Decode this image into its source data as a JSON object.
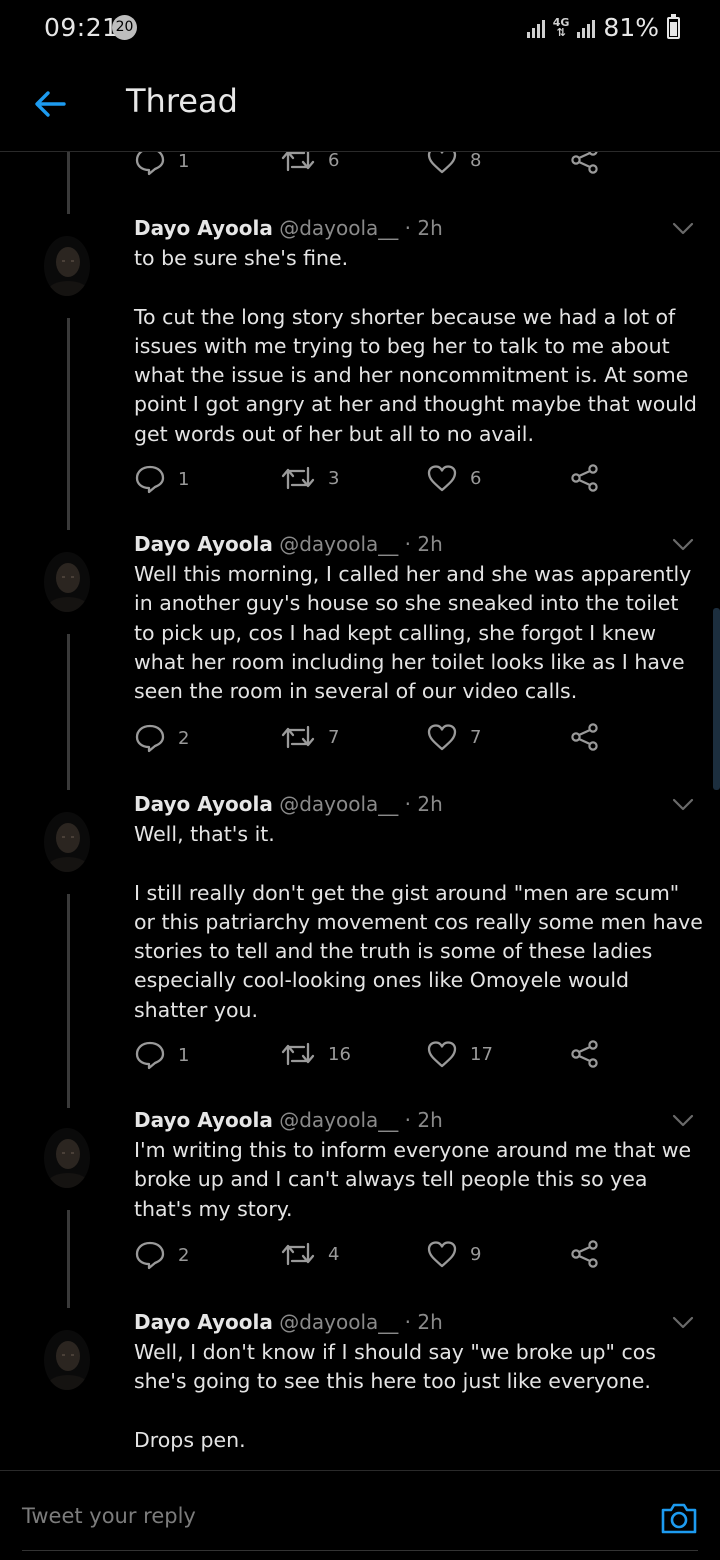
{
  "status_bar": {
    "time": "09:21",
    "notification_count": "20",
    "network": "4G",
    "battery": "81%"
  },
  "header": {
    "title": "Thread"
  },
  "top_actions": {
    "reply_count": "1",
    "retweet_count": "6",
    "like_count": "8"
  },
  "tweets": [
    {
      "name": "Dayo Ayoola",
      "handle": "@dayoola__",
      "time": "· 2h",
      "text": "to be sure she's fine.\n\nTo cut the long story shorter because we had a lot of issues with me trying to beg her to talk to me about what the issue is and her noncommitment is. At some point I got angry at her and thought maybe that would get words out of her but all to no avail.",
      "replies": "1",
      "retweets": "3",
      "likes": "6"
    },
    {
      "name": "Dayo Ayoola",
      "handle": "@dayoola__",
      "time": "· 2h",
      "text": "Well this morning, I called her and she was apparently in another guy's house so she sneaked into the toilet to pick up, cos I had kept calling, she forgot I knew what her room including her toilet looks like as I have seen the room in several of our video calls.",
      "replies": "2",
      "retweets": "7",
      "likes": "7"
    },
    {
      "name": "Dayo Ayoola",
      "handle": "@dayoola__",
      "time": "· 2h",
      "text": "Well, that's it.\n\nI still really don't get the gist around \"men are scum\" or this patriarchy movement cos really some men have stories to tell and the truth is some of these ladies especially cool-looking ones like Omoyele would shatter you.",
      "replies": "1",
      "retweets": "16",
      "likes": "17"
    },
    {
      "name": "Dayo Ayoola",
      "handle": "@dayoola__",
      "time": "· 2h",
      "text": "I'm writing this to inform everyone around me that we broke up and I can't always tell people this so yea that's my story.",
      "replies": "2",
      "retweets": "4",
      "likes": "9"
    },
    {
      "name": "Dayo Ayoola",
      "handle": "@dayoola__",
      "time": "· 2h",
      "text": "Well, I don't know if I should say \"we broke up\" cos she's going to see this here too just like everyone.\n\nDrops pen.",
      "replies": "",
      "retweets": "",
      "likes": ""
    }
  ],
  "reply_bar": {
    "placeholder": "Tweet your reply"
  },
  "icons": {
    "back": "arrow-left-icon",
    "reply": "speech-bubble-icon",
    "retweet": "retweet-arrows-icon",
    "like": "heart-icon",
    "share": "share-nodes-icon",
    "camera": "camera-icon",
    "menu": "chevron-down-icon"
  },
  "colors": {
    "accent": "#1da1f2",
    "background": "#000000",
    "muted": "#8a8a8a"
  }
}
